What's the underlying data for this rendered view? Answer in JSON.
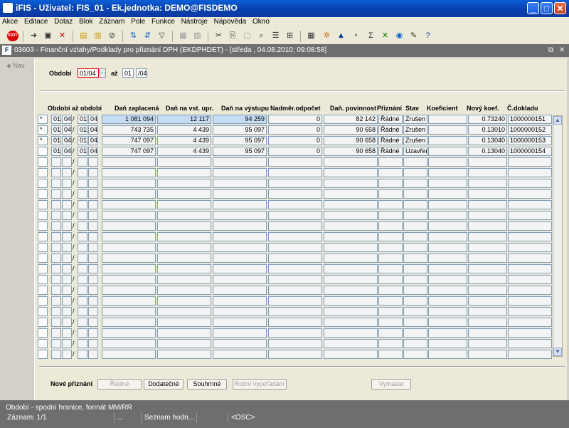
{
  "window": {
    "title": "iFIS - Uživatel: FIS_01 - Ek.jednotka: DEMO@FISDEMO"
  },
  "menu": [
    "Akce",
    "Editace",
    "Dotaz",
    "Blok",
    "Záznam",
    "Pole",
    "Funkce",
    "Nástroje",
    "Nápověda",
    "Okno"
  ],
  "toolbar": {
    "exit_label": "EXIT"
  },
  "form": {
    "title": "03603 - Finanční vztahy/Podklady pro přiznání DPH (EKDPHDET) - [středa , 04.08.2010; 09:08:58]",
    "nav_label": "Nav",
    "period_label": "Období",
    "period_from": "01/04",
    "period_to_label": "až",
    "period_to_month": "01",
    "period_to_year": "/04"
  },
  "table": {
    "headers": {
      "period": "Období až období",
      "dan_zaplacena": "Daň zaplacená",
      "dan_vst": "Daň na vst. upr.",
      "dan_vystup": "Daň na výstupu",
      "nadmer": "Nadměr.odpočet",
      "povinnost": "Daň. povinnost",
      "priznani": "Přiznání",
      "stav": "Stav",
      "koef": "Koeficient",
      "novy_koef": "Nový koef.",
      "doklad": "Č.dokladu"
    },
    "rows": [
      {
        "mark": "*",
        "m1": "01",
        "y1": "04",
        "sep": "/",
        "m2": "01",
        "y2": "04",
        "zaplacena": "1 081 094",
        "vst": "12 117",
        "vystup": "94 259",
        "nadmer": "0",
        "povinnost": "82 142",
        "priznani": "Řádné",
        "stav": "Zrušen",
        "koef": "",
        "novy": "0.73240",
        "doklad": "1000000151"
      },
      {
        "mark": "*",
        "m1": "01",
        "y1": "04",
        "sep": "/",
        "m2": "01",
        "y2": "04",
        "zaplacena": "743 735",
        "vst": "4 439",
        "vystup": "95 097",
        "nadmer": "0",
        "povinnost": "90 658",
        "priznani": "Řádné",
        "stav": "Zrušen",
        "koef": "",
        "novy": "0.13010",
        "doklad": "1000000152"
      },
      {
        "mark": "*",
        "m1": "01",
        "y1": "04",
        "sep": "/",
        "m2": "01",
        "y2": "04",
        "zaplacena": "747 097",
        "vst": "4 439",
        "vystup": "95 097",
        "nadmer": "0",
        "povinnost": "90 658",
        "priznani": "Řádné",
        "stav": "Zrušen",
        "koef": "",
        "novy": "0.13040",
        "doklad": "1000000153"
      },
      {
        "mark": "",
        "m1": "01",
        "y1": "04",
        "sep": "/",
        "m2": "01",
        "y2": "04",
        "zaplacena": "747 097",
        "vst": "4 439",
        "vystup": "95 097",
        "nadmer": "0",
        "povinnost": "90 658",
        "priznani": "Řádné",
        "stav": "Uzavřen",
        "koef": "",
        "novy": "0.13040",
        "doklad": "1000000154"
      }
    ],
    "empty_sep": "/"
  },
  "footer": {
    "label": "Nové přiznání",
    "btn_radne": "Řádné",
    "btn_dodatecne": "Dodatečné",
    "btn_souhrnne": "Souhrnné",
    "btn_rocni": "Roční vypořádání",
    "btn_vymazat": "Vymazat"
  },
  "status": {
    "hint": "Období - spodní hranice, formát MM/RR",
    "record": "Záznam: 1/1",
    "dots": "...",
    "list": "Seznam hodn...",
    "osc": "<OSC>"
  },
  "colors": {
    "title_blue": "#0842b0",
    "selected_row": "#c5dcf3",
    "status_gray": "#6e6e6e"
  }
}
